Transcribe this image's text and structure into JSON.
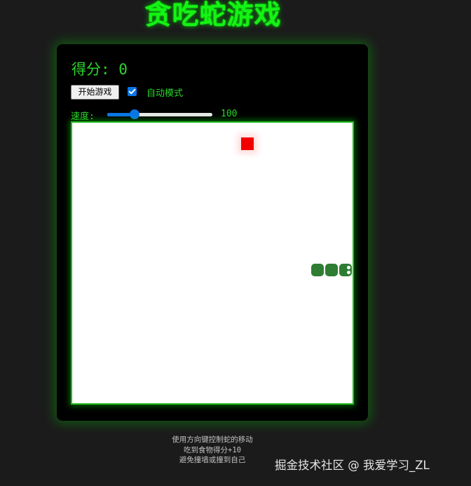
{
  "title": "贪吃蛇游戏",
  "score": {
    "label": "得分: ",
    "value": "0"
  },
  "controls": {
    "start_label": "开始游戏",
    "auto_checked": true,
    "auto_label": "自动模式",
    "speed_label": "速度:",
    "speed_value": "100",
    "speed_fraction": 0.233
  },
  "board": {
    "grid_size": 20,
    "food": {
      "col": 12,
      "row": 1
    },
    "snake": [
      {
        "col": 17,
        "row": 10
      },
      {
        "col": 18,
        "row": 10
      },
      {
        "col": 19,
        "row": 10
      }
    ]
  },
  "instructions": [
    "使用方向键控制蛇的移动",
    "吃到食物得分+10",
    "避免撞墙或撞到自己"
  ],
  "watermark": "掘金技术社区 @ 我爱学习_ZL",
  "icons": {
    "checkbox": "checkmark-icon",
    "food": "food-icon",
    "snake_head": "snake-head-icon"
  },
  "colors": {
    "accent": "#2bd62b",
    "title": "#16f216",
    "board_border": "#22bb22",
    "food": "#f20000",
    "snake": "#2e7d32",
    "checkbox": "#0a75e6",
    "background": "#1b1b1b"
  }
}
